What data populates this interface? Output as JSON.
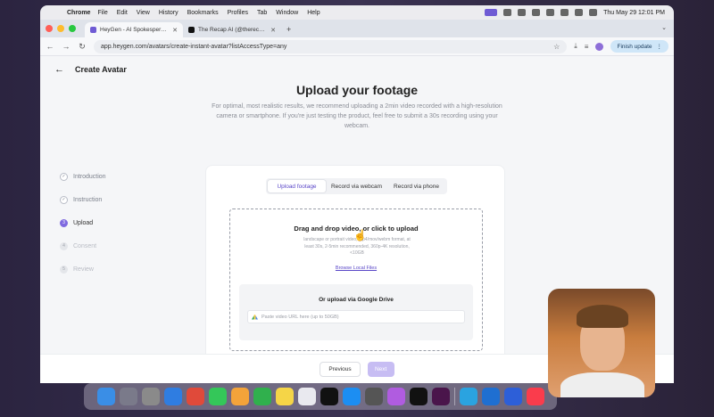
{
  "menubar": {
    "app": "Chrome",
    "items": [
      "File",
      "Edit",
      "View",
      "History",
      "Bookmarks",
      "Profiles",
      "Tab",
      "Window",
      "Help"
    ],
    "clock": "Thu May 29  12:01 PM"
  },
  "browser": {
    "tabs": [
      {
        "title": "HeyGen - AI Spokesperson Vi"
      },
      {
        "title": "The Recap AI (@therecapai)"
      }
    ],
    "new_tab": "+",
    "url": "app.heygen.com/avatars/create-instant-avatar?listAccessType=any",
    "update_label": "Finish update"
  },
  "page": {
    "title": "Create Avatar",
    "heading": "Upload your footage",
    "subheading": "For optimal, most realistic results, we recommend uploading a 2min video recorded with a high-resolution camera or smartphone. If you're just testing the product, feel free to submit a 30s recording using your webcam.",
    "steps": [
      {
        "label": "Introduction",
        "marker": "✓",
        "state": "done"
      },
      {
        "label": "Instruction",
        "marker": "✓",
        "state": "done"
      },
      {
        "label": "Upload",
        "marker": "3",
        "state": "active"
      },
      {
        "label": "Consent",
        "marker": "4",
        "state": "pending"
      },
      {
        "label": "Review",
        "marker": "5",
        "state": "pending"
      }
    ],
    "tabs": [
      "Upload footage",
      "Record via webcam",
      "Record via phone"
    ],
    "active_tab": "Upload footage",
    "drop_title": "Drag and drop video, or click to upload",
    "drop_hint": "landscape or portrait video, mp4/mov/webm format, at least 30s, 2-5min recommended, 360p-4K resolution, <10GB",
    "browse_label": "Browse Local Files",
    "gdrive_title": "Or upload via Google Drive",
    "gdrive_placeholder": "Paste video URL here (up to 50GB)",
    "prev_label": "Previous",
    "next_label": "Next"
  },
  "colors": {
    "accent": "#7f6ae0",
    "next_disabled": "#c7bdf3"
  },
  "dock_icons": [
    "finder-icon",
    "launchpad-icon",
    "settings-icon",
    "safari-icon",
    "chrome-icon",
    "messages-icon",
    "photos-icon",
    "facetime-icon",
    "notes-icon",
    "freeform-icon",
    "appletv-icon",
    "appstore-icon",
    "quicktime-icon",
    "podcasts-icon",
    "capcut-icon",
    "slack-icon",
    "telegram-icon",
    "vscode-icon",
    "1password-icon",
    "music-icon"
  ]
}
